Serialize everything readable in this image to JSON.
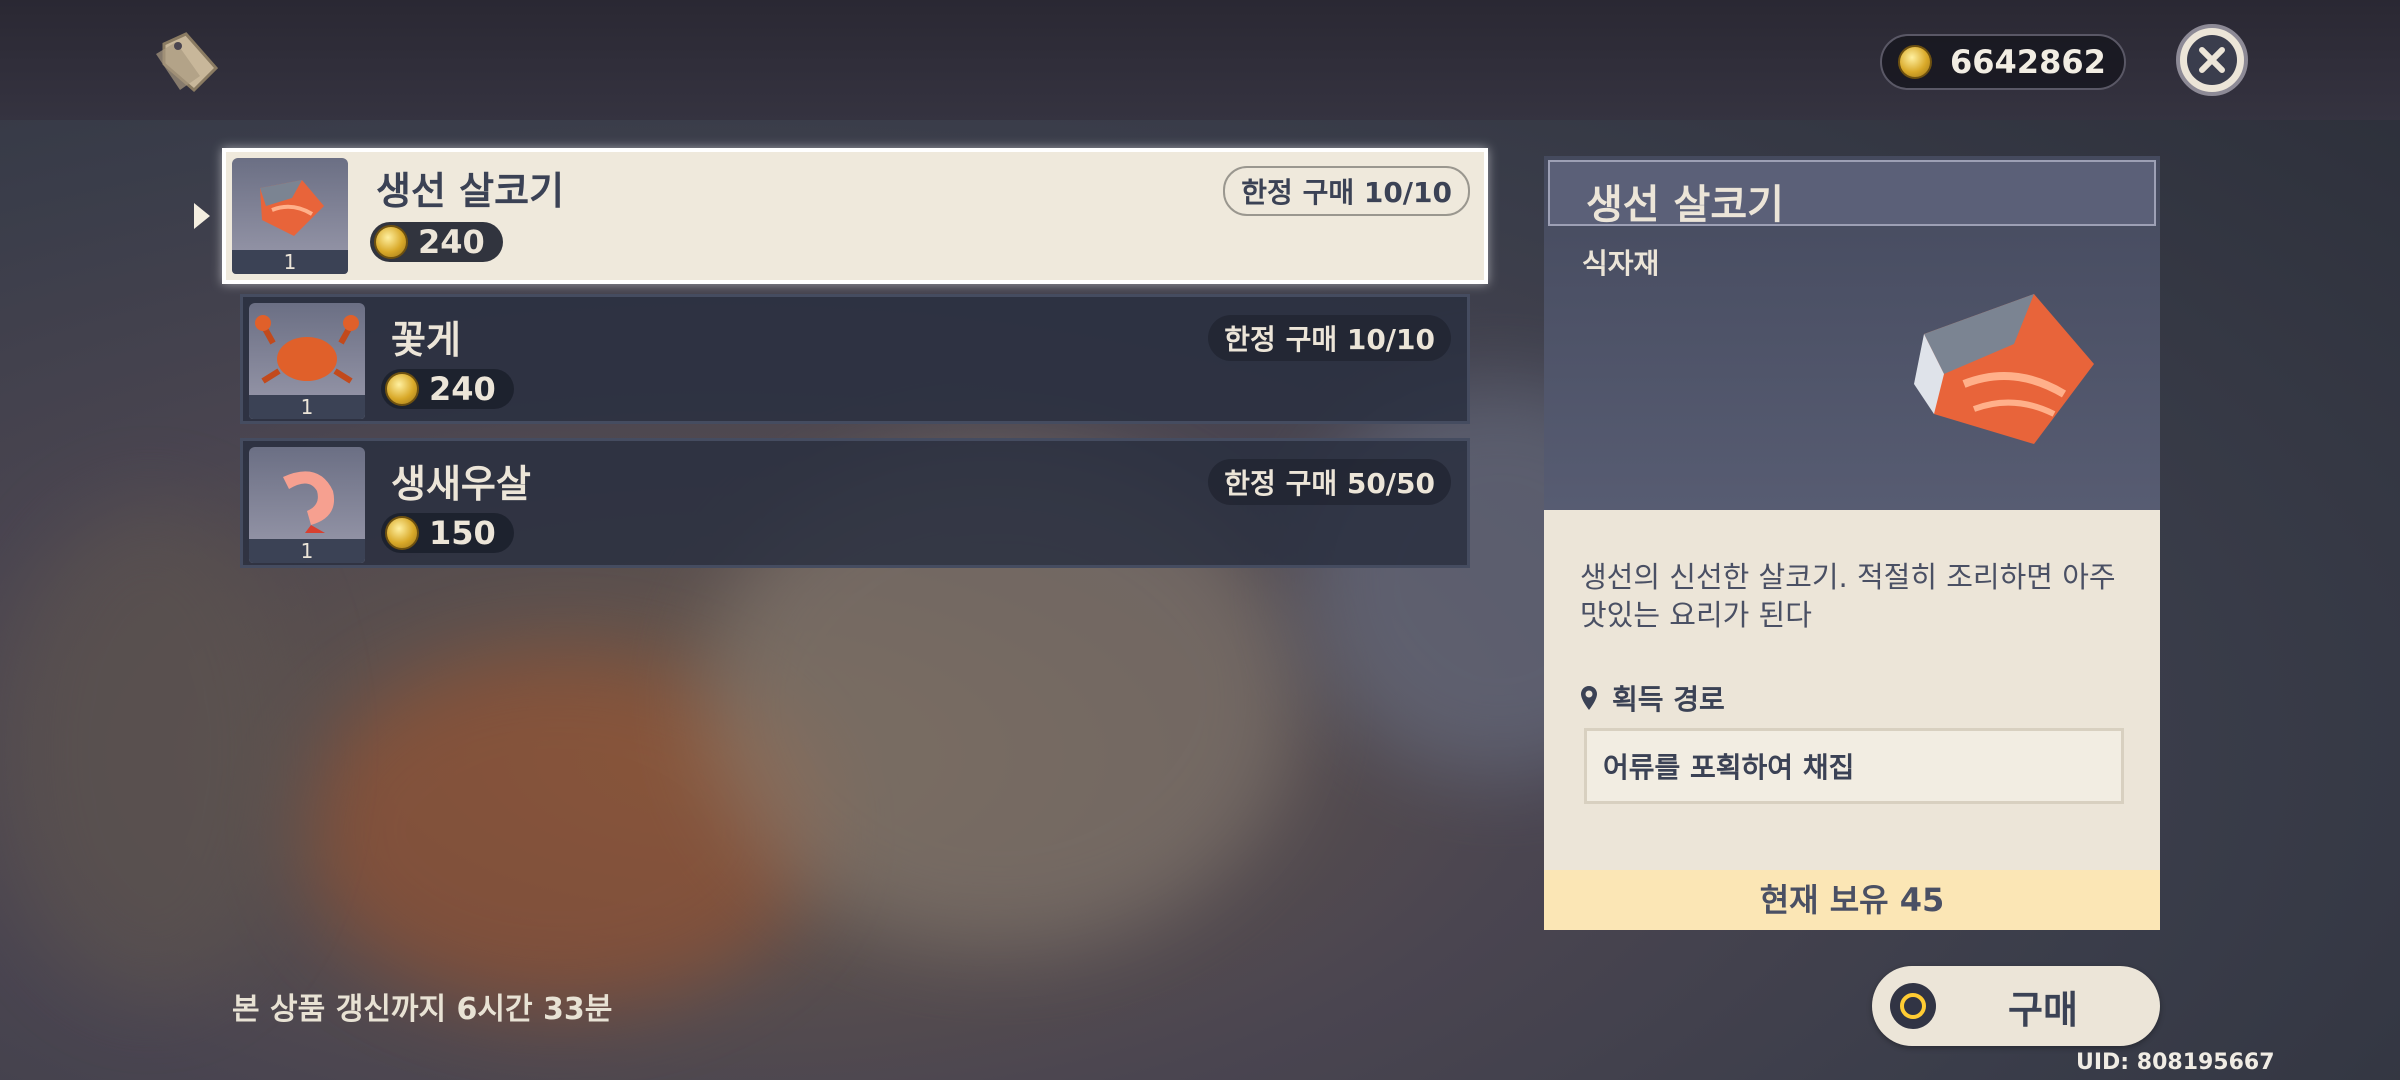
{
  "header": {
    "coin_amount": "6642862"
  },
  "shop_items": [
    {
      "name": "생선 살코기",
      "price": "240",
      "limit": "한정 구매 10/10",
      "quantity": "1",
      "selected": true,
      "icon": "fish-fillet-icon"
    },
    {
      "name": "꽃게",
      "price": "240",
      "limit": "한정 구매 10/10",
      "quantity": "1",
      "selected": false,
      "icon": "crab-icon"
    },
    {
      "name": "생새우살",
      "price": "150",
      "limit": "한정 구매 50/50",
      "quantity": "1",
      "selected": false,
      "icon": "shrimp-icon"
    }
  ],
  "detail": {
    "title": "생선 살코기",
    "type": "식자재",
    "description": "생선의 신선한 살코기. 적절히 조리하면 아주 맛있는 요리가 된다",
    "source_heading": "획득 경로",
    "source": "어류를 포획하여 채집",
    "owned": "현재 보유 45"
  },
  "footer": {
    "refresh_text": "본 상품 갱신까지 6시간 33분",
    "buy_label": "구매",
    "uid": "UID: 808195667"
  },
  "colors": {
    "card_selected": "#efe9dc",
    "card_dark": "#2a3040",
    "owned_bar": "#fbe6b5",
    "accent_coin": "#d9a929"
  }
}
